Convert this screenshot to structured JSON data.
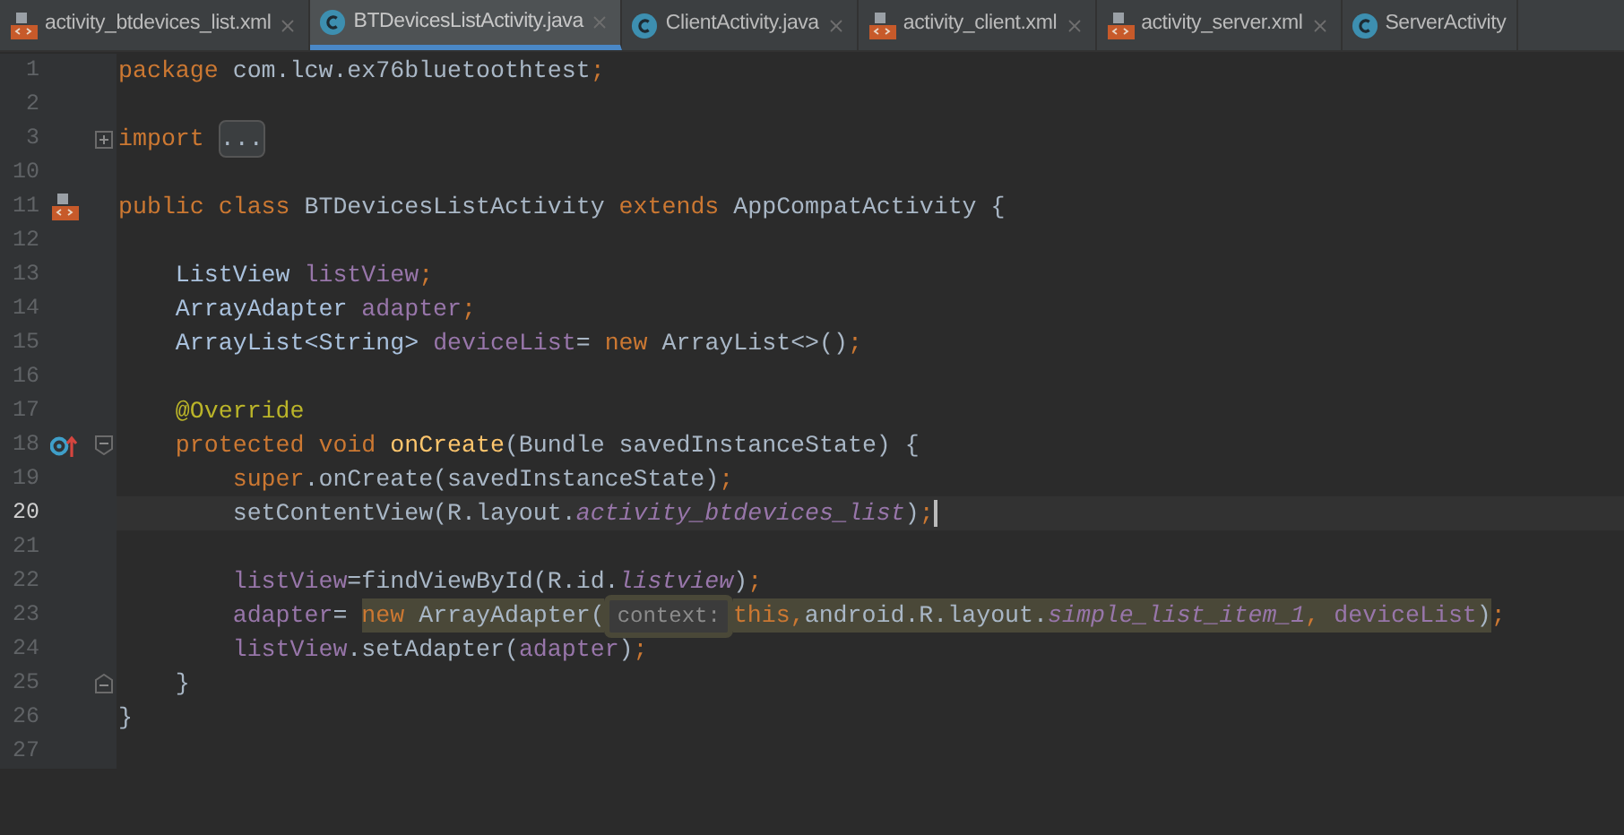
{
  "tabs": [
    {
      "label": "activity_btdevices_list.xml",
      "kind": "xml",
      "selected": false
    },
    {
      "label": "BTDevicesListActivity.java",
      "kind": "java",
      "selected": true
    },
    {
      "label": "ClientActivity.java",
      "kind": "java",
      "selected": false
    },
    {
      "label": "activity_client.xml",
      "kind": "xml",
      "selected": false
    },
    {
      "label": "activity_server.xml",
      "kind": "xml",
      "selected": false
    },
    {
      "label": "ServerActivity",
      "kind": "java",
      "selected": false
    }
  ],
  "lines": [
    {
      "number": "1",
      "current": false,
      "tokens": [
        {
          "t": "package ",
          "kind": "kw"
        },
        {
          "t": "com.lcw.ex76bluetoothtest",
          "kind": "plain"
        },
        {
          "t": ";",
          "kind": "kw"
        }
      ]
    },
    {
      "number": "2",
      "current": false
    },
    {
      "number": "3",
      "current": false,
      "fold": {
        "kind": "collapsed"
      },
      "tokens": [
        {
          "t": "import ",
          "kind": "kw"
        },
        {
          "t": "...",
          "kind": "folded"
        }
      ]
    },
    {
      "number": "10",
      "current": false
    },
    {
      "number": "11",
      "current": false,
      "gutter": {
        "kind": "layout"
      },
      "tokens": [
        {
          "t": "public class ",
          "kind": "kw"
        },
        {
          "t": "BTDevicesListActivity ",
          "kind": "plain"
        },
        {
          "t": "extends ",
          "kind": "kw"
        },
        {
          "t": "AppCompatActivity {",
          "kind": "plain"
        }
      ]
    },
    {
      "number": "12",
      "current": false
    },
    {
      "number": "13",
      "current": false,
      "tokens": [
        {
          "t": "    ListView ",
          "kind": "type"
        },
        {
          "t": "listView",
          "kind": "field"
        },
        {
          "t": ";",
          "kind": "kw"
        }
      ]
    },
    {
      "number": "14",
      "current": false,
      "tokens": [
        {
          "t": "    ArrayAdapter ",
          "kind": "type"
        },
        {
          "t": "adapter",
          "kind": "field"
        },
        {
          "t": ";",
          "kind": "kw"
        }
      ]
    },
    {
      "number": "15",
      "current": false,
      "tokens": [
        {
          "t": "    ArrayList<String> ",
          "kind": "type"
        },
        {
          "t": "deviceList",
          "kind": "field"
        },
        {
          "t": "= ",
          "kind": "plain"
        },
        {
          "t": "new ",
          "kind": "kw"
        },
        {
          "t": "ArrayList<>()",
          "kind": "plain"
        },
        {
          "t": ";",
          "kind": "kw"
        }
      ]
    },
    {
      "number": "16",
      "current": false
    },
    {
      "number": "17",
      "current": false,
      "tokens": [
        {
          "t": "    @Override",
          "kind": "annotation"
        }
      ]
    },
    {
      "number": "18",
      "current": false,
      "gutter": {
        "kind": "override"
      },
      "fold": {
        "kind": "open"
      },
      "tokens": [
        {
          "t": "    protected void ",
          "kind": "kw"
        },
        {
          "t": "onCreate",
          "kind": "method"
        },
        {
          "t": "(Bundle savedInstanceState) {",
          "kind": "plain"
        }
      ]
    },
    {
      "number": "19",
      "current": false,
      "tokens": [
        {
          "t": "        super",
          "kind": "kw"
        },
        {
          "t": ".onCreate(savedInstanceState)",
          "kind": "plain"
        },
        {
          "t": ";",
          "kind": "kw"
        }
      ]
    },
    {
      "number": "20",
      "current": true,
      "tokens": [
        {
          "t": "        setContentView(R.layout.",
          "kind": "plain"
        },
        {
          "t": "activity_btdevices_list",
          "kind": "static"
        },
        {
          "t": ")",
          "kind": "plain"
        },
        {
          "t": ";",
          "kind": "kw"
        }
      ]
    },
    {
      "number": "21",
      "current": false
    },
    {
      "number": "22",
      "current": false,
      "tokens": [
        {
          "t": "        listView",
          "kind": "field"
        },
        {
          "t": "=findViewById(R.id.",
          "kind": "plain"
        },
        {
          "t": "listview",
          "kind": "static"
        },
        {
          "t": ")",
          "kind": "plain"
        },
        {
          "t": ";",
          "kind": "kw"
        }
      ]
    },
    {
      "number": "23",
      "current": false,
      "tokens": [
        {
          "t": "        adapter",
          "kind": "field",
          "highlighted": false
        },
        {
          "t": "= ",
          "kind": "plain",
          "highlighted": false
        },
        {
          "t": "new ",
          "kind": "kw",
          "highlighted": true
        },
        {
          "t": "ArrayAdapter(",
          "kind": "plain",
          "highlighted": true
        },
        {
          "t": "context:",
          "kind": "hint",
          "highlighted": true
        },
        {
          "t": "this,",
          "kind": "kw",
          "highlighted": true
        },
        {
          "t": "android.R.layout.",
          "kind": "plain",
          "highlighted": true
        },
        {
          "t": "simple_list_item_1",
          "kind": "static",
          "highlighted": true
        },
        {
          "t": ", ",
          "kind": "kw",
          "highlighted": true
        },
        {
          "t": "deviceList",
          "kind": "field",
          "highlighted": true
        },
        {
          "t": ")",
          "kind": "plain",
          "highlighted": true
        },
        {
          "t": ";",
          "kind": "kw",
          "highlighted": false
        }
      ]
    },
    {
      "number": "24",
      "current": false,
      "tokens": [
        {
          "t": "        listView",
          "kind": "field"
        },
        {
          "t": ".setAdapter(",
          "kind": "plain"
        },
        {
          "t": "adapter",
          "kind": "field"
        },
        {
          "t": ")",
          "kind": "plain"
        },
        {
          "t": ";",
          "kind": "kw"
        }
      ]
    },
    {
      "number": "25",
      "current": false,
      "fold": {
        "kind": "end"
      },
      "tokens": [
        {
          "t": "    }",
          "kind": "plain"
        }
      ]
    },
    {
      "number": "26",
      "current": false,
      "tokens": [
        {
          "t": "}",
          "kind": "plain"
        }
      ]
    },
    {
      "number": "27",
      "current": false
    }
  ]
}
